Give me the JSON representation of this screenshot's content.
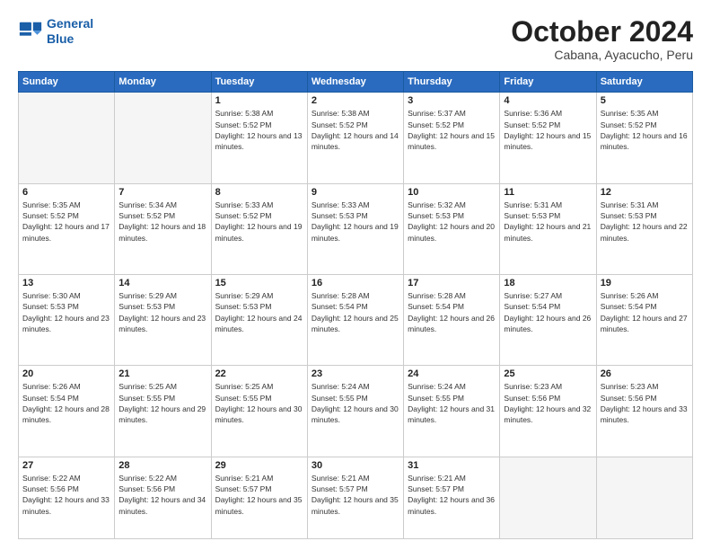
{
  "header": {
    "logo_line1": "General",
    "logo_line2": "Blue",
    "month_title": "October 2024",
    "subtitle": "Cabana, Ayacucho, Peru"
  },
  "weekdays": [
    "Sunday",
    "Monday",
    "Tuesday",
    "Wednesday",
    "Thursday",
    "Friday",
    "Saturday"
  ],
  "weeks": [
    [
      {
        "day": "",
        "info": ""
      },
      {
        "day": "",
        "info": ""
      },
      {
        "day": "1",
        "info": "Sunrise: 5:38 AM\nSunset: 5:52 PM\nDaylight: 12 hours and 13 minutes."
      },
      {
        "day": "2",
        "info": "Sunrise: 5:38 AM\nSunset: 5:52 PM\nDaylight: 12 hours and 14 minutes."
      },
      {
        "day": "3",
        "info": "Sunrise: 5:37 AM\nSunset: 5:52 PM\nDaylight: 12 hours and 15 minutes."
      },
      {
        "day": "4",
        "info": "Sunrise: 5:36 AM\nSunset: 5:52 PM\nDaylight: 12 hours and 15 minutes."
      },
      {
        "day": "5",
        "info": "Sunrise: 5:35 AM\nSunset: 5:52 PM\nDaylight: 12 hours and 16 minutes."
      }
    ],
    [
      {
        "day": "6",
        "info": "Sunrise: 5:35 AM\nSunset: 5:52 PM\nDaylight: 12 hours and 17 minutes."
      },
      {
        "day": "7",
        "info": "Sunrise: 5:34 AM\nSunset: 5:52 PM\nDaylight: 12 hours and 18 minutes."
      },
      {
        "day": "8",
        "info": "Sunrise: 5:33 AM\nSunset: 5:52 PM\nDaylight: 12 hours and 19 minutes."
      },
      {
        "day": "9",
        "info": "Sunrise: 5:33 AM\nSunset: 5:53 PM\nDaylight: 12 hours and 19 minutes."
      },
      {
        "day": "10",
        "info": "Sunrise: 5:32 AM\nSunset: 5:53 PM\nDaylight: 12 hours and 20 minutes."
      },
      {
        "day": "11",
        "info": "Sunrise: 5:31 AM\nSunset: 5:53 PM\nDaylight: 12 hours and 21 minutes."
      },
      {
        "day": "12",
        "info": "Sunrise: 5:31 AM\nSunset: 5:53 PM\nDaylight: 12 hours and 22 minutes."
      }
    ],
    [
      {
        "day": "13",
        "info": "Sunrise: 5:30 AM\nSunset: 5:53 PM\nDaylight: 12 hours and 23 minutes."
      },
      {
        "day": "14",
        "info": "Sunrise: 5:29 AM\nSunset: 5:53 PM\nDaylight: 12 hours and 23 minutes."
      },
      {
        "day": "15",
        "info": "Sunrise: 5:29 AM\nSunset: 5:53 PM\nDaylight: 12 hours and 24 minutes."
      },
      {
        "day": "16",
        "info": "Sunrise: 5:28 AM\nSunset: 5:54 PM\nDaylight: 12 hours and 25 minutes."
      },
      {
        "day": "17",
        "info": "Sunrise: 5:28 AM\nSunset: 5:54 PM\nDaylight: 12 hours and 26 minutes."
      },
      {
        "day": "18",
        "info": "Sunrise: 5:27 AM\nSunset: 5:54 PM\nDaylight: 12 hours and 26 minutes."
      },
      {
        "day": "19",
        "info": "Sunrise: 5:26 AM\nSunset: 5:54 PM\nDaylight: 12 hours and 27 minutes."
      }
    ],
    [
      {
        "day": "20",
        "info": "Sunrise: 5:26 AM\nSunset: 5:54 PM\nDaylight: 12 hours and 28 minutes."
      },
      {
        "day": "21",
        "info": "Sunrise: 5:25 AM\nSunset: 5:55 PM\nDaylight: 12 hours and 29 minutes."
      },
      {
        "day": "22",
        "info": "Sunrise: 5:25 AM\nSunset: 5:55 PM\nDaylight: 12 hours and 30 minutes."
      },
      {
        "day": "23",
        "info": "Sunrise: 5:24 AM\nSunset: 5:55 PM\nDaylight: 12 hours and 30 minutes."
      },
      {
        "day": "24",
        "info": "Sunrise: 5:24 AM\nSunset: 5:55 PM\nDaylight: 12 hours and 31 minutes."
      },
      {
        "day": "25",
        "info": "Sunrise: 5:23 AM\nSunset: 5:56 PM\nDaylight: 12 hours and 32 minutes."
      },
      {
        "day": "26",
        "info": "Sunrise: 5:23 AM\nSunset: 5:56 PM\nDaylight: 12 hours and 33 minutes."
      }
    ],
    [
      {
        "day": "27",
        "info": "Sunrise: 5:22 AM\nSunset: 5:56 PM\nDaylight: 12 hours and 33 minutes."
      },
      {
        "day": "28",
        "info": "Sunrise: 5:22 AM\nSunset: 5:56 PM\nDaylight: 12 hours and 34 minutes."
      },
      {
        "day": "29",
        "info": "Sunrise: 5:21 AM\nSunset: 5:57 PM\nDaylight: 12 hours and 35 minutes."
      },
      {
        "day": "30",
        "info": "Sunrise: 5:21 AM\nSunset: 5:57 PM\nDaylight: 12 hours and 35 minutes."
      },
      {
        "day": "31",
        "info": "Sunrise: 5:21 AM\nSunset: 5:57 PM\nDaylight: 12 hours and 36 minutes."
      },
      {
        "day": "",
        "info": ""
      },
      {
        "day": "",
        "info": ""
      }
    ]
  ]
}
